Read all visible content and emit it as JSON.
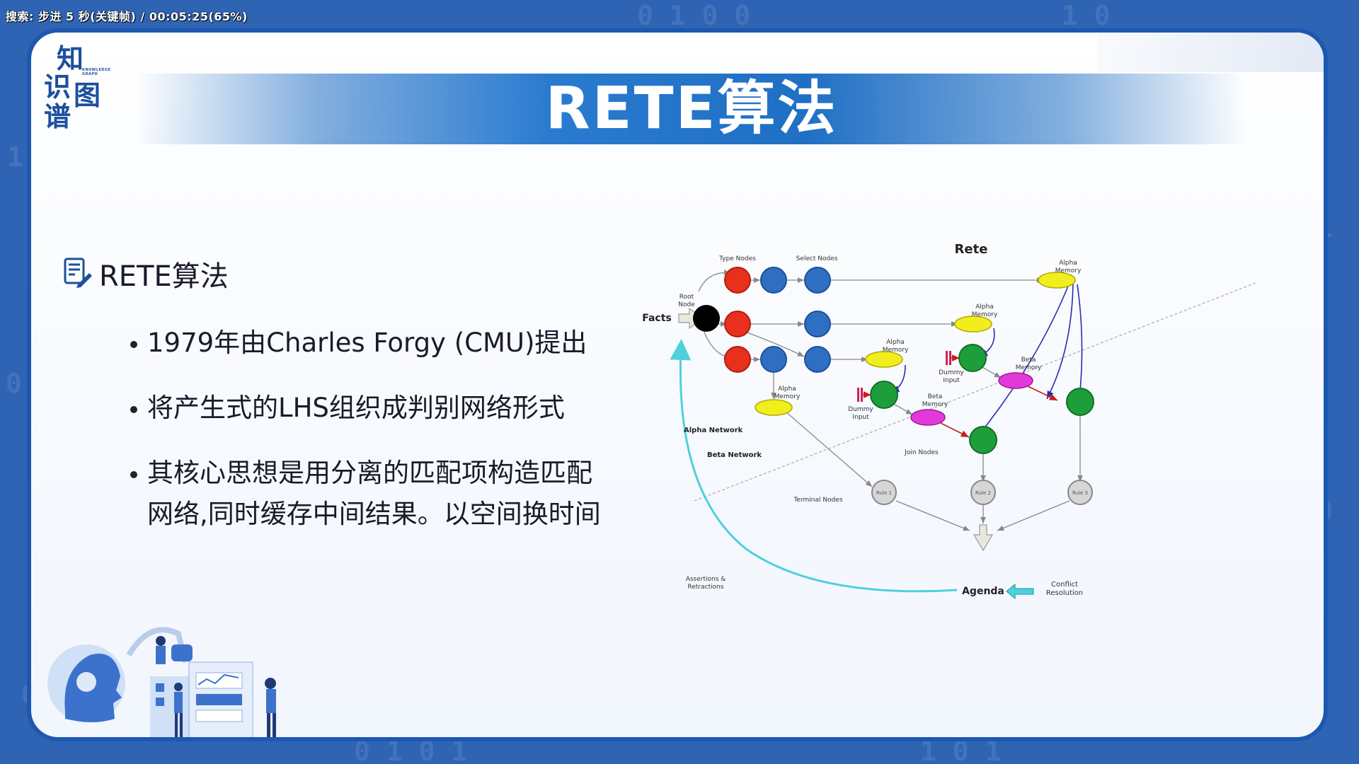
{
  "status_bar": {
    "text": "搜索: 步进 5 秒(关键帧) / 00:05:25(65%)"
  },
  "slide": {
    "title": "RETE算法",
    "logo": {
      "char1": "知",
      "char2": "识",
      "char3": "图",
      "char4": "谱",
      "small_text": "KNOWLEDGE GRAPH"
    },
    "section_heading": "RETE算法",
    "bullets": [
      {
        "line1": "1979年由Charles Forgy (CMU)提出",
        "line2": ""
      },
      {
        "line1": "将产生式的LHS组织成判别网络形式",
        "line2": ""
      },
      {
        "line1": "其核心思想是用分离的匹配项构造匹配",
        "line2": "网络,同时缓存中间结果。以空间换时间"
      }
    ]
  },
  "diagram": {
    "title": "Rete",
    "labels": {
      "type_nodes": "Type Nodes",
      "select_nodes": "Select Nodes",
      "root_node_1": "Root",
      "root_node_2": "Node",
      "facts": "Facts",
      "alpha_memory_1": "Alpha",
      "alpha_memory_2": "Memory",
      "dummy_input_1": "Dummy",
      "dummy_input_2": "Input",
      "beta_memory_1": "Beta",
      "beta_memory_2": "Memory",
      "alpha_network": "Alpha Network",
      "beta_network": "Beta Network",
      "join_nodes": "Join Nodes",
      "terminal_nodes": "Terminal Nodes",
      "rule1": "Rule 1",
      "rule2": "Rule 2",
      "rule3": "Rule 3",
      "assertions_1": "Assertions &",
      "assertions_2": "Retractions",
      "agenda": "Agenda",
      "conflict_1": "Conflict",
      "conflict_2": "Resolution"
    },
    "colors": {
      "type_node": "#e8301c",
      "select_node": "#2f6fc2",
      "root_node": "#000000",
      "alpha_memory": "#f2ee1e",
      "join_node": "#1e9e3a",
      "beta_memory": "#e23ad8",
      "terminal_node": "#d6d6d6",
      "feedback_arrow": "#4fd0dc",
      "dummy_input": "#d0205a"
    }
  }
}
